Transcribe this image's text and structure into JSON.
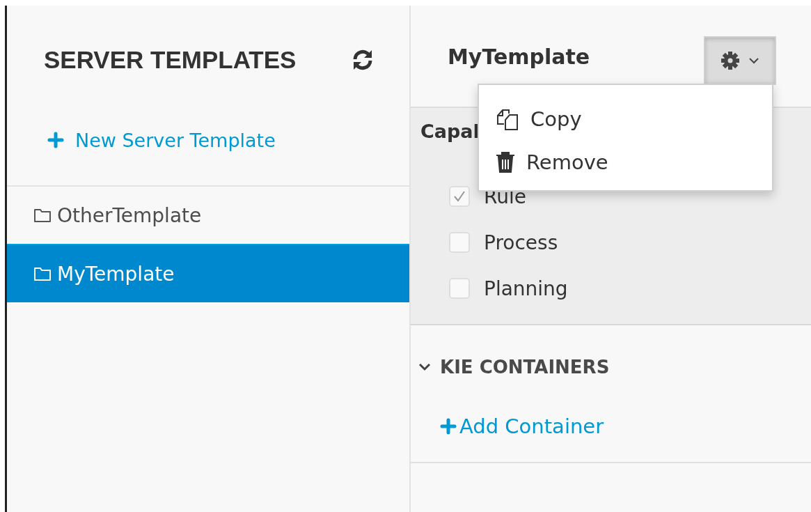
{
  "sidebar": {
    "title": "SERVER TEMPLATES",
    "new_button": "New Server Template",
    "items": [
      {
        "label": "OtherTemplate",
        "selected": false
      },
      {
        "label": "MyTemplate",
        "selected": true
      }
    ]
  },
  "detail": {
    "title": "MyTemplate",
    "settings_menu": {
      "expanded": true,
      "items": [
        {
          "kind": "copy",
          "label": "Copy"
        },
        {
          "kind": "remove",
          "label": "Remove"
        }
      ]
    },
    "capabilities": {
      "heading": "Capal",
      "options": [
        {
          "label": "Rule",
          "checked": true
        },
        {
          "label": "Process",
          "checked": false
        },
        {
          "label": "Planning",
          "checked": false
        }
      ]
    },
    "kie_containers": {
      "heading": "KIE CONTAINERS",
      "expanded": true,
      "add_button": "Add Container"
    }
  }
}
